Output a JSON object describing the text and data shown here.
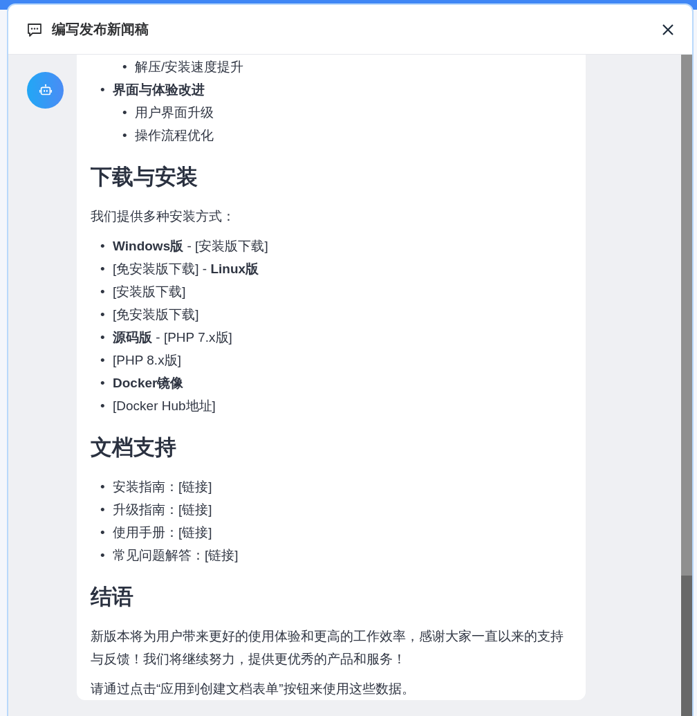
{
  "dialog": {
    "title": "编写发布新闻稿"
  },
  "content": [
    {
      "kind": "list",
      "items": [
        {
          "children": [
            {
              "marker": "•",
              "text": "解压/安装速度提升"
            }
          ]
        }
      ]
    },
    {
      "kind": "list",
      "items": [
        {
          "marker": "•",
          "text": "**界面与体验改进**",
          "children": [
            {
              "marker": "•",
              "text": "用户界面升级"
            },
            {
              "marker": "•",
              "text": "操作流程优化"
            }
          ]
        }
      ]
    },
    {
      "kind": "heading",
      "text": "下载与安装"
    },
    {
      "kind": "paragraph",
      "text": "我们提供多种安装方式："
    },
    {
      "kind": "list",
      "items": [
        {
          "marker": "•",
          "text": "**Windows版** - [安装版下载]"
        },
        {
          "marker": "•",
          "text": "[免安装版下载] - **Linux版**"
        },
        {
          "marker": "•",
          "text": "[安装版下载]"
        },
        {
          "marker": "•",
          "text": "[免安装版下载]"
        },
        {
          "marker": "•",
          "text": "**源码版** - [PHP 7.x版]"
        },
        {
          "marker": "•",
          "text": "[PHP 8.x版]"
        },
        {
          "marker": "•",
          "text": "**Docker镜像**"
        },
        {
          "marker": "•",
          "text": "[Docker Hub地址]"
        }
      ]
    },
    {
      "kind": "heading",
      "text": "文档支持"
    },
    {
      "kind": "list",
      "items": [
        {
          "marker": "•",
          "text": "安装指南：[链接]"
        },
        {
          "marker": "•",
          "text": "升级指南：[链接]"
        },
        {
          "marker": "•",
          "text": "使用手册：[链接]"
        },
        {
          "marker": "•",
          "text": "常见问题解答：[链接]"
        }
      ]
    },
    {
      "kind": "heading",
      "text": "结语"
    },
    {
      "kind": "paragraph",
      "text": "新版本将为用户带来更好的使用体验和更高的工作效率，感谢大家一直以来的支持与反馈！我们将继续努力，提供更优秀的产品和服务！"
    },
    {
      "kind": "paragraph",
      "text": "请通过点击“应用到创建文档表单”按钮来使用这些数据。"
    }
  ]
}
